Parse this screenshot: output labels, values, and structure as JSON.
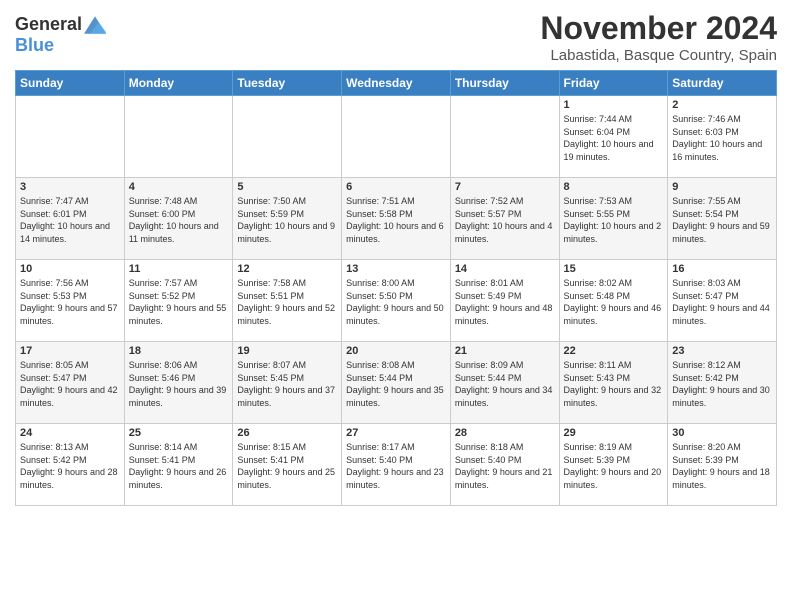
{
  "header": {
    "logo_line1": "General",
    "logo_line2": "Blue",
    "title": "November 2024",
    "subtitle": "Labastida, Basque Country, Spain"
  },
  "weekdays": [
    "Sunday",
    "Monday",
    "Tuesday",
    "Wednesday",
    "Thursday",
    "Friday",
    "Saturday"
  ],
  "weeks": [
    [
      {
        "day": "",
        "info": ""
      },
      {
        "day": "",
        "info": ""
      },
      {
        "day": "",
        "info": ""
      },
      {
        "day": "",
        "info": ""
      },
      {
        "day": "",
        "info": ""
      },
      {
        "day": "1",
        "info": "Sunrise: 7:44 AM\nSunset: 6:04 PM\nDaylight: 10 hours and 19 minutes."
      },
      {
        "day": "2",
        "info": "Sunrise: 7:46 AM\nSunset: 6:03 PM\nDaylight: 10 hours and 16 minutes."
      }
    ],
    [
      {
        "day": "3",
        "info": "Sunrise: 7:47 AM\nSunset: 6:01 PM\nDaylight: 10 hours and 14 minutes."
      },
      {
        "day": "4",
        "info": "Sunrise: 7:48 AM\nSunset: 6:00 PM\nDaylight: 10 hours and 11 minutes."
      },
      {
        "day": "5",
        "info": "Sunrise: 7:50 AM\nSunset: 5:59 PM\nDaylight: 10 hours and 9 minutes."
      },
      {
        "day": "6",
        "info": "Sunrise: 7:51 AM\nSunset: 5:58 PM\nDaylight: 10 hours and 6 minutes."
      },
      {
        "day": "7",
        "info": "Sunrise: 7:52 AM\nSunset: 5:57 PM\nDaylight: 10 hours and 4 minutes."
      },
      {
        "day": "8",
        "info": "Sunrise: 7:53 AM\nSunset: 5:55 PM\nDaylight: 10 hours and 2 minutes."
      },
      {
        "day": "9",
        "info": "Sunrise: 7:55 AM\nSunset: 5:54 PM\nDaylight: 9 hours and 59 minutes."
      }
    ],
    [
      {
        "day": "10",
        "info": "Sunrise: 7:56 AM\nSunset: 5:53 PM\nDaylight: 9 hours and 57 minutes."
      },
      {
        "day": "11",
        "info": "Sunrise: 7:57 AM\nSunset: 5:52 PM\nDaylight: 9 hours and 55 minutes."
      },
      {
        "day": "12",
        "info": "Sunrise: 7:58 AM\nSunset: 5:51 PM\nDaylight: 9 hours and 52 minutes."
      },
      {
        "day": "13",
        "info": "Sunrise: 8:00 AM\nSunset: 5:50 PM\nDaylight: 9 hours and 50 minutes."
      },
      {
        "day": "14",
        "info": "Sunrise: 8:01 AM\nSunset: 5:49 PM\nDaylight: 9 hours and 48 minutes."
      },
      {
        "day": "15",
        "info": "Sunrise: 8:02 AM\nSunset: 5:48 PM\nDaylight: 9 hours and 46 minutes."
      },
      {
        "day": "16",
        "info": "Sunrise: 8:03 AM\nSunset: 5:47 PM\nDaylight: 9 hours and 44 minutes."
      }
    ],
    [
      {
        "day": "17",
        "info": "Sunrise: 8:05 AM\nSunset: 5:47 PM\nDaylight: 9 hours and 42 minutes."
      },
      {
        "day": "18",
        "info": "Sunrise: 8:06 AM\nSunset: 5:46 PM\nDaylight: 9 hours and 39 minutes."
      },
      {
        "day": "19",
        "info": "Sunrise: 8:07 AM\nSunset: 5:45 PM\nDaylight: 9 hours and 37 minutes."
      },
      {
        "day": "20",
        "info": "Sunrise: 8:08 AM\nSunset: 5:44 PM\nDaylight: 9 hours and 35 minutes."
      },
      {
        "day": "21",
        "info": "Sunrise: 8:09 AM\nSunset: 5:44 PM\nDaylight: 9 hours and 34 minutes."
      },
      {
        "day": "22",
        "info": "Sunrise: 8:11 AM\nSunset: 5:43 PM\nDaylight: 9 hours and 32 minutes."
      },
      {
        "day": "23",
        "info": "Sunrise: 8:12 AM\nSunset: 5:42 PM\nDaylight: 9 hours and 30 minutes."
      }
    ],
    [
      {
        "day": "24",
        "info": "Sunrise: 8:13 AM\nSunset: 5:42 PM\nDaylight: 9 hours and 28 minutes."
      },
      {
        "day": "25",
        "info": "Sunrise: 8:14 AM\nSunset: 5:41 PM\nDaylight: 9 hours and 26 minutes."
      },
      {
        "day": "26",
        "info": "Sunrise: 8:15 AM\nSunset: 5:41 PM\nDaylight: 9 hours and 25 minutes."
      },
      {
        "day": "27",
        "info": "Sunrise: 8:17 AM\nSunset: 5:40 PM\nDaylight: 9 hours and 23 minutes."
      },
      {
        "day": "28",
        "info": "Sunrise: 8:18 AM\nSunset: 5:40 PM\nDaylight: 9 hours and 21 minutes."
      },
      {
        "day": "29",
        "info": "Sunrise: 8:19 AM\nSunset: 5:39 PM\nDaylight: 9 hours and 20 minutes."
      },
      {
        "day": "30",
        "info": "Sunrise: 8:20 AM\nSunset: 5:39 PM\nDaylight: 9 hours and 18 minutes."
      }
    ]
  ]
}
